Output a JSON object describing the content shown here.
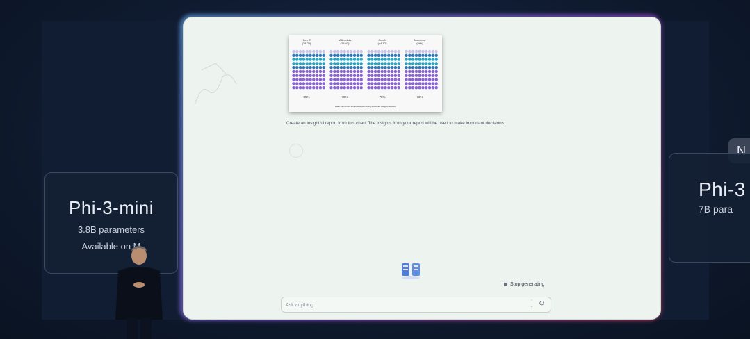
{
  "left_card": {
    "title": "Phi-3-mini",
    "params": "3.8B parameters",
    "availability": "Available on M"
  },
  "right_card": {
    "badge": "N",
    "title": "Phi-3",
    "params": "7B para"
  },
  "chart_image": {
    "groups": [
      {
        "name": "Gen Z",
        "age": "(18-28)",
        "percent": "85%"
      },
      {
        "name": "Millennials",
        "age": "(29-43)",
        "percent": "78%"
      },
      {
        "name": "Gen X",
        "age": "(44-57)",
        "percent": "76%"
      },
      {
        "name": "Boomers+",
        "age": "(58+)",
        "percent": "73%"
      }
    ],
    "caption": "Base: All current employees (excluding those not using AI at work)"
  },
  "prompt": "Create an insightful report from this chart. The insights from your report will be used to make important decisions.",
  "stop_label": "Stop generating",
  "input": {
    "placeholder": "Ask anything"
  },
  "colors": {
    "dot_lavender": "#c9c3e6",
    "dot_blue": "#2f79b8",
    "dot_teal": "#2aa3c0",
    "dot_purple": "#8a63d2"
  },
  "icons": {
    "stop": "stop-square-icon",
    "send": "send-icon",
    "loading": "loading-animation-icon"
  }
}
